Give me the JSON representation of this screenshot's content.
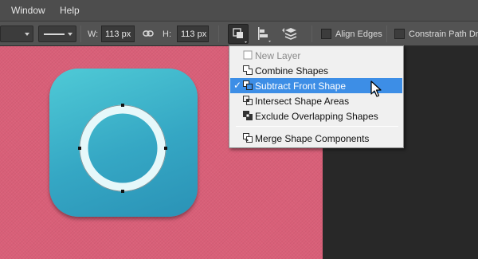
{
  "menubar": {
    "items": [
      "Window",
      "Help"
    ]
  },
  "options": {
    "width_label": "W:",
    "width_value": "113 px",
    "height_label": "H:",
    "height_value": "113 px",
    "align_edges_label": "Align Edges",
    "constrain_label": "Constrain Path Drag"
  },
  "shape_menu": {
    "items": [
      {
        "label": "New Layer",
        "icon": "new-layer-icon",
        "state": "disabled"
      },
      {
        "label": "Combine Shapes",
        "icon": "combine-shapes-icon",
        "state": "normal"
      },
      {
        "label": "Subtract Front Shape",
        "icon": "subtract-front-shape-icon",
        "state": "selected",
        "checked": true
      },
      {
        "label": "Intersect Shape Areas",
        "icon": "intersect-shape-areas-icon",
        "state": "normal"
      },
      {
        "label": "Exclude Overlapping Shapes",
        "icon": "exclude-overlapping-shapes-icon",
        "state": "normal"
      },
      {
        "label": "Merge Shape Components",
        "icon": "merge-shape-components-icon",
        "state": "normal"
      }
    ],
    "check_glyph": "✓"
  },
  "colors": {
    "canvas": "#d95f78",
    "icon_gradient_top": "#4fcad6",
    "icon_gradient_bottom": "#2a92b6",
    "ring": "#e6f8fa",
    "menu_highlight": "#3d8ee6"
  }
}
